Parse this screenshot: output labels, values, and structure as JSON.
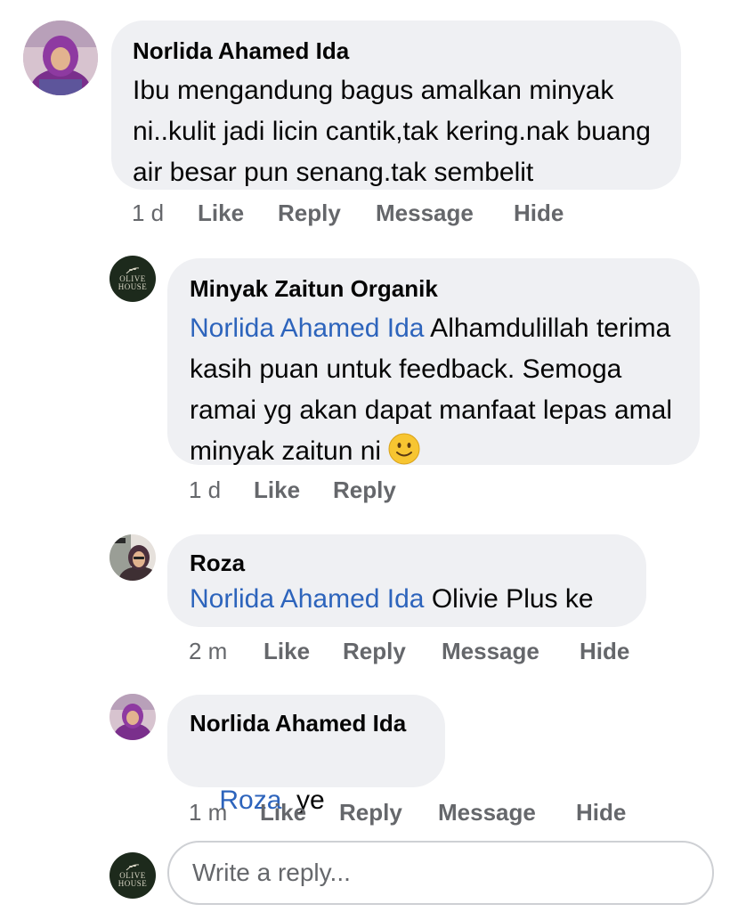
{
  "comments": [
    {
      "author": "Norlida Ahamed Ida",
      "text": "Ibu mengandung bagus amalkan minyak ni..kulit jadi licin cantik,tak kering.nak buang air besar pun senang.tak sembelit",
      "time": "1 d",
      "actions": [
        "Like",
        "Reply",
        "Message",
        "Hide"
      ]
    },
    {
      "author": "Minyak Zaitun Organik",
      "mention": "Norlida Ahamed Ida",
      "text": " Alhamdulillah terima kasih puan untuk feedback. Semoga ramai yg akan dapat manfaat lepas amal minyak zaitun ni ",
      "emoji": "🙂",
      "time": "1 d",
      "actions": [
        "Like",
        "Reply"
      ],
      "logo_text": [
        "OLIVE",
        "HOUSE"
      ]
    },
    {
      "author": "Roza",
      "mention": "Norlida Ahamed Ida",
      "text": " Olivie Plus ke",
      "time": "2 m",
      "actions": [
        "Like",
        "Reply",
        "Message",
        "Hide"
      ]
    },
    {
      "author": "Norlida Ahamed Ida",
      "mention": "Roza",
      "text": "  ye",
      "time": "1 m",
      "actions": [
        "Like",
        "Reply",
        "Message",
        "Hide"
      ]
    }
  ],
  "reply_box": {
    "placeholder": "Write a reply...",
    "logo_text": [
      "OLIVE",
      "HOUSE"
    ]
  },
  "colors": {
    "bubble": "#eff0f3",
    "mention": "#2d64bc",
    "secondary_text": "#65676b",
    "olive_logo_bg": "#1d2a1c"
  }
}
